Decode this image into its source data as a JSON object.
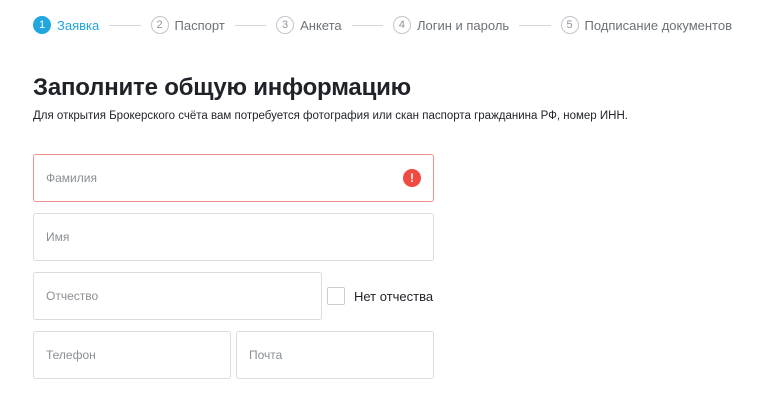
{
  "stepper": {
    "steps": [
      {
        "number": "1",
        "label": "Заявка",
        "active": true
      },
      {
        "number": "2",
        "label": "Паспорт",
        "active": false
      },
      {
        "number": "3",
        "label": "Анкета",
        "active": false
      },
      {
        "number": "4",
        "label": "Логин и пароль",
        "active": false
      },
      {
        "number": "5",
        "label": "Подписание документов",
        "active": false
      }
    ]
  },
  "form": {
    "title": "Заполните общую информацию",
    "subtitle": "Для открытия Брокерского счёта вам потребуется фотография или скан паспорта гражданина РФ, номер ИНН.",
    "fields": {
      "last_name": {
        "placeholder": "Фамилия",
        "value": "",
        "error_icon": "!"
      },
      "first_name": {
        "placeholder": "Имя",
        "value": ""
      },
      "middle_name": {
        "placeholder": "Отчество",
        "value": ""
      },
      "phone": {
        "placeholder": "Телефон",
        "value": ""
      },
      "email": {
        "placeholder": "Почта",
        "value": ""
      }
    },
    "no_middle_name": {
      "label": "Нет отчества",
      "checked": false
    }
  },
  "colors": {
    "accent": "#21a6e0",
    "error": "#f24a41",
    "error_border": "#ef8f8f",
    "text": "#1f2229",
    "muted": "#8a8f96"
  }
}
